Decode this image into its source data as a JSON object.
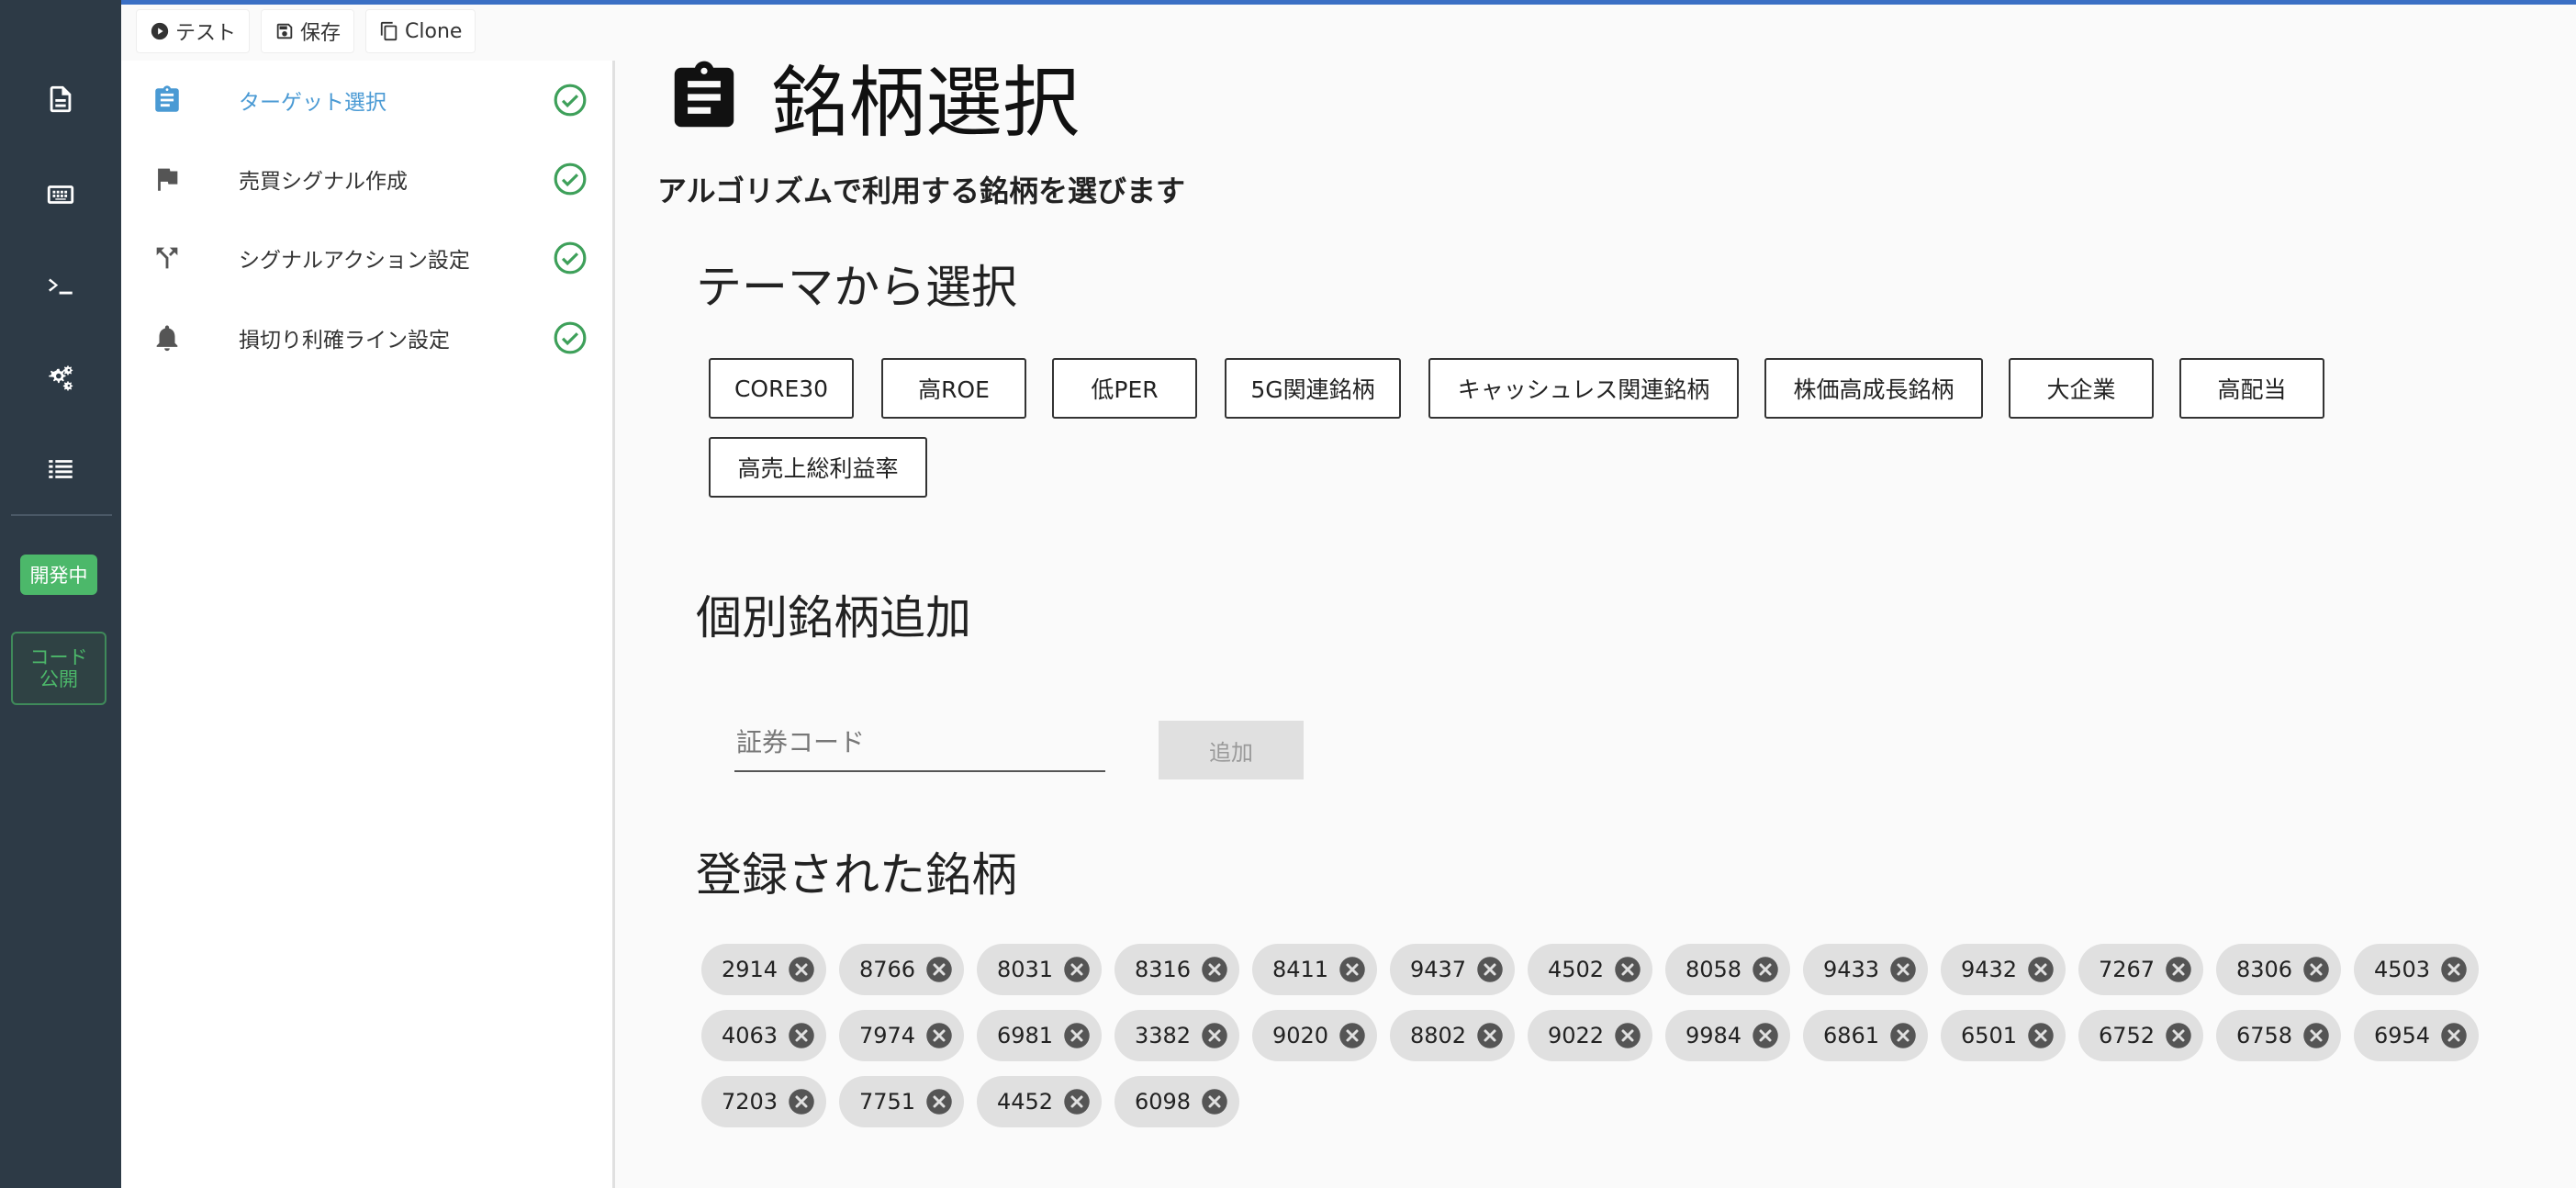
{
  "toolbar": {
    "test_label": "テスト",
    "save_label": "保存",
    "clone_label": "Clone"
  },
  "rail": {
    "icons": [
      "document-icon",
      "keyboard-icon",
      "terminal-icon",
      "gears-icon",
      "list-icon"
    ],
    "status_badge": "開発中",
    "code_badge_line1": "コード",
    "code_badge_line2": "公開"
  },
  "steps": [
    {
      "label": "ターゲット選択",
      "icon": "clipboard-icon",
      "done": true,
      "active": true
    },
    {
      "label": "売買シグナル作成",
      "icon": "flag-icon",
      "done": true,
      "active": false
    },
    {
      "label": "シグナルアクション設定",
      "icon": "fork-icon",
      "done": true,
      "active": false
    },
    {
      "label": "損切り利確ライン設定",
      "icon": "bell-icon",
      "done": true,
      "active": false
    }
  ],
  "main": {
    "title": "銘柄選択",
    "subtitle": "アルゴリズムで利用する銘柄を選びます",
    "theme_heading": "テーマから選択",
    "themes": [
      "CORE30",
      "高ROE",
      "低PER",
      "5G関連銘柄",
      "キャッシュレス関連銘柄",
      "株価高成長銘柄",
      "大企業",
      "高配当",
      "高売上総利益率"
    ],
    "add_heading": "個別銘柄追加",
    "code_placeholder": "証券コード",
    "add_button": "追加",
    "registered_heading": "登録された銘柄",
    "registered": [
      "2914",
      "8766",
      "8031",
      "8316",
      "8411",
      "9437",
      "4502",
      "8058",
      "9433",
      "9432",
      "7267",
      "8306",
      "4503",
      "4063",
      "7974",
      "6981",
      "3382",
      "9020",
      "8802",
      "9022",
      "9984",
      "6861",
      "6501",
      "6752",
      "6758",
      "6954",
      "7203",
      "7751",
      "4452",
      "6098"
    ]
  },
  "colors": {
    "rail": "#2d3a46",
    "accent": "#4a9ad4",
    "check": "#3ea05a",
    "badge_green": "#4cb86a"
  }
}
